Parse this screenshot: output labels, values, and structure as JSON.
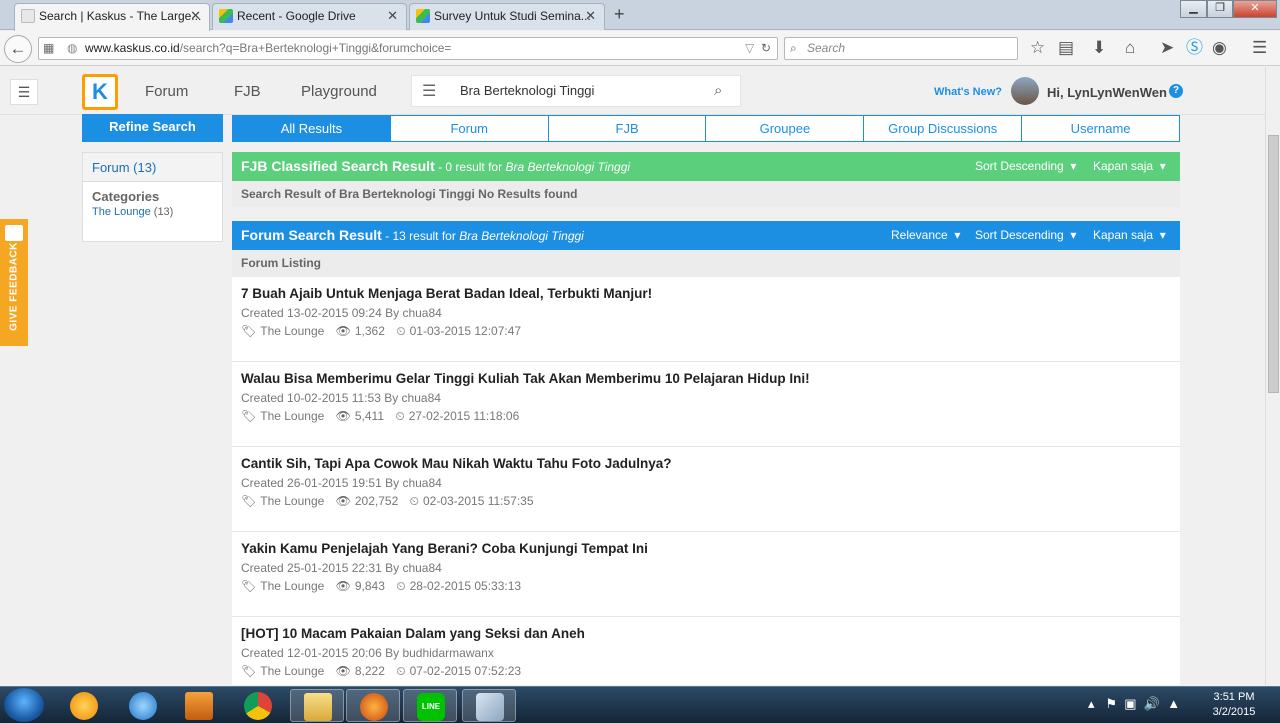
{
  "browser": {
    "tabs": [
      {
        "title": "Search | Kaskus - The Large...",
        "active": true
      },
      {
        "title": "Recent - Google Drive",
        "active": false
      },
      {
        "title": "Survey Untuk Studi Semina...",
        "active": false
      }
    ],
    "url_domain": "www.kaskus.co.id",
    "url_path": "/search?q=Bra+Berteknologi+Tinggi&forumchoice=",
    "search_placeholder": "Search"
  },
  "header": {
    "nav": [
      "Forum",
      "FJB",
      "Playground"
    ],
    "search_value": "Bra Berteknologi Tinggi",
    "whats_new": "What's New?",
    "greeting": "Hi, LynLynWenWen"
  },
  "sidebar": {
    "refine_label": "Refine Search",
    "forum_filter": "Forum (13)",
    "categories_label": "Categories",
    "category_name": "The Lounge",
    "category_count": "(13)"
  },
  "result_tabs": [
    "All Results",
    "Forum",
    "FJB",
    "Groupee",
    "Group Discussions",
    "Username"
  ],
  "fjb": {
    "title": "FJB Classified Search Result",
    "summary_prefix": " - 0 result for ",
    "query": "Bra Berteknologi Tinggi",
    "sort": "Sort Descending",
    "time": "Kapan saja",
    "no_result": "Search Result of Bra Berteknologi Tinggi No Results found"
  },
  "forum": {
    "title": "Forum Search Result",
    "summary_prefix": " - 13 result for ",
    "query": "Bra Berteknologi Tinggi",
    "relevance": "Relevance",
    "sort": "Sort Descending",
    "time": "Kapan saja",
    "listing_label": "Forum Listing"
  },
  "results": [
    {
      "title": "7 Buah Ajaib Untuk Menjaga Berat Badan Ideal, Terbukti Manjur!",
      "created": "Created 13-02-2015 09:24 By chua84",
      "category": "The Lounge",
      "views": "1,362",
      "last": "01-03-2015 12:07:47"
    },
    {
      "title": "Walau Bisa Memberimu Gelar Tinggi Kuliah Tak Akan Memberimu 10 Pelajaran Hidup Ini!",
      "created": "Created 10-02-2015 11:53 By chua84",
      "category": "The Lounge",
      "views": "5,411",
      "last": "27-02-2015 11:18:06"
    },
    {
      "title": "Cantik Sih, Tapi Apa Cowok Mau Nikah Waktu Tahu Foto Jadulnya?",
      "created": "Created 26-01-2015 19:51 By chua84",
      "category": "The Lounge",
      "views": "202,752",
      "last": "02-03-2015 11:57:35"
    },
    {
      "title": "Yakin Kamu Penjelajah Yang Berani? Coba Kunjungi Tempat Ini",
      "created": "Created 25-01-2015 22:31 By chua84",
      "category": "The Lounge",
      "views": "9,843",
      "last": "28-02-2015 05:33:13"
    },
    {
      "title": "[HOT] 10 Macam Pakaian Dalam yang Seksi dan Aneh",
      "created": "Created 12-01-2015 20:06 By budhidarmawanx",
      "category": "The Lounge",
      "views": "8,222",
      "last": "07-02-2015 07:52:23"
    }
  ],
  "feedback_label": "GIVE FEEDBACK",
  "taskbar": {
    "time": "3:51 PM",
    "date": "3/2/2015"
  }
}
